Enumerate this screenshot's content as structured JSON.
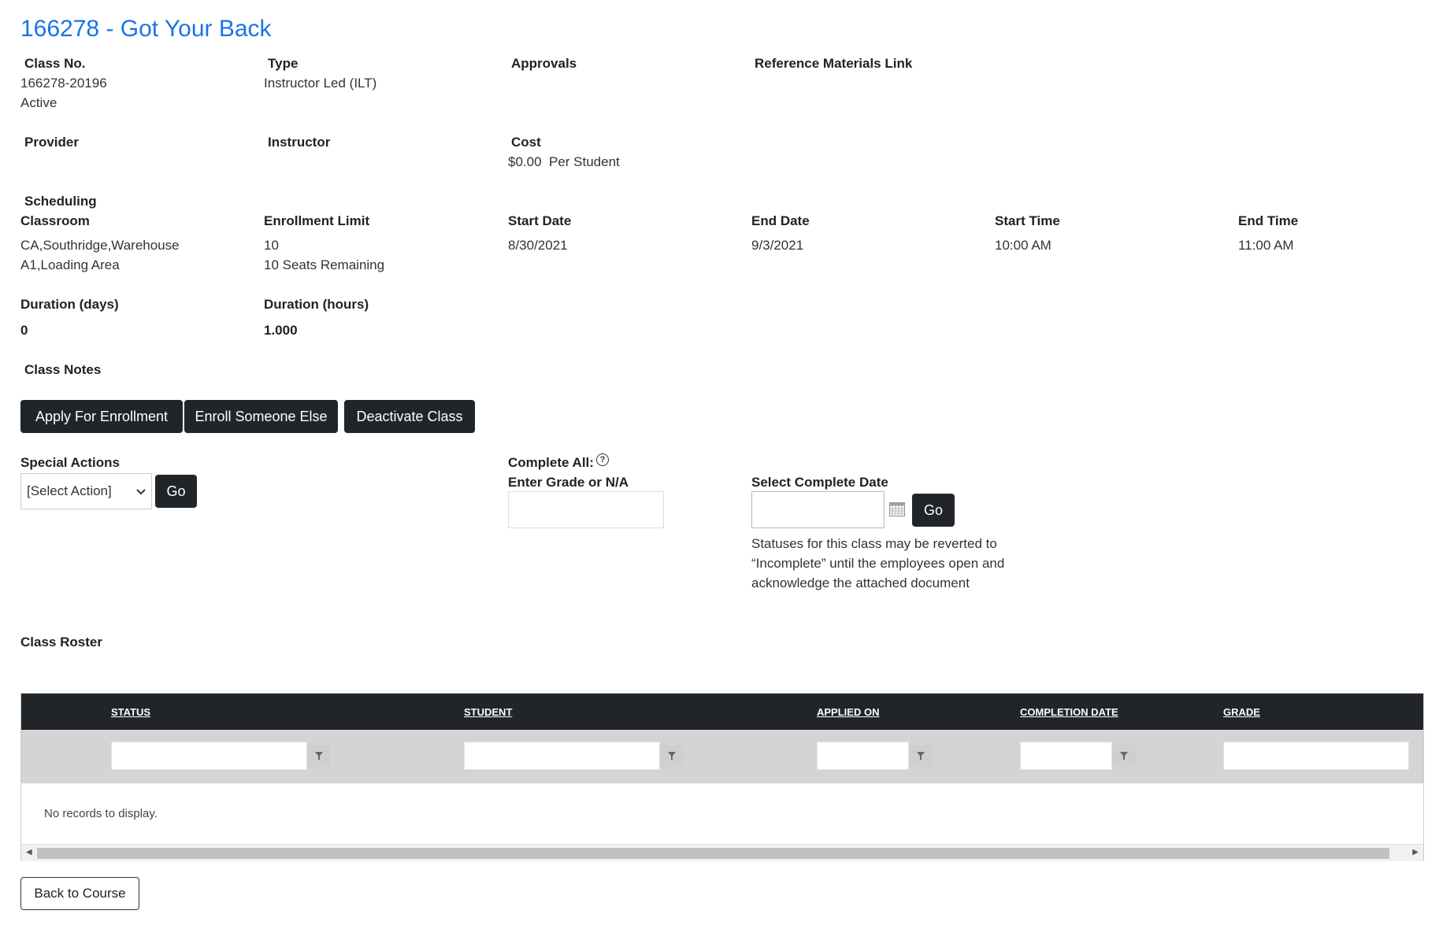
{
  "page_title": "166278 - Got Your Back",
  "class_info": {
    "class_no_label": "Class No.",
    "class_no_value": "166278-20196",
    "status_value": "Active",
    "type_label": "Type",
    "type_value": "Instructor Led (ILT)",
    "approvals_label": "Approvals",
    "reference_label": "Reference Materials Link",
    "provider_label": "Provider",
    "instructor_label": "Instructor",
    "cost_label": "Cost",
    "cost_value": "$0.00  Per Student"
  },
  "scheduling": {
    "section_label": "Scheduling",
    "classroom_label": "Classroom",
    "classroom_line1": "CA,Southridge,Warehouse",
    "classroom_line2": "A1,Loading Area",
    "enrollment_limit_label": "Enrollment Limit",
    "enrollment_limit_value": "10",
    "seats_remaining": "10 Seats Remaining",
    "start_date_label": "Start Date",
    "start_date_value": "8/30/2021",
    "end_date_label": "End Date",
    "end_date_value": "9/3/2021",
    "start_time_label": "Start Time",
    "start_time_value": "10:00 AM",
    "end_time_label": "End Time",
    "end_time_value": "11:00 AM",
    "duration_days_label": "Duration (days)",
    "duration_days_value": "0",
    "duration_hours_label": "Duration (hours)",
    "duration_hours_value": "1.000"
  },
  "class_notes_label": "Class Notes",
  "actions": {
    "apply_label": "Apply For Enrollment",
    "enroll_else_label": "Enroll Someone Else",
    "deactivate_label": "Deactivate Class"
  },
  "special_actions": {
    "label": "Special Actions",
    "selected": "[Select Action]",
    "go_label": "Go"
  },
  "complete_all": {
    "label": "Complete All:",
    "grade_label": "Enter Grade or N/A",
    "date_label": "Select Complete Date",
    "go_label": "Go",
    "note_line1": "Statuses for this class may be reverted to",
    "note_line2": "“Incomplete” until the employees open and",
    "note_line3": "acknowledge the attached document"
  },
  "roster": {
    "label": "Class Roster",
    "columns": [
      "STATUS",
      "STUDENT",
      "APPLIED ON",
      "COMPLETION DATE",
      "GRADE"
    ],
    "empty_message": "No records to display."
  },
  "back_label": "Back to Course",
  "colors": {
    "title": "#1a73e8",
    "dark": "#212529",
    "filter_row": "#d4d4d4"
  }
}
